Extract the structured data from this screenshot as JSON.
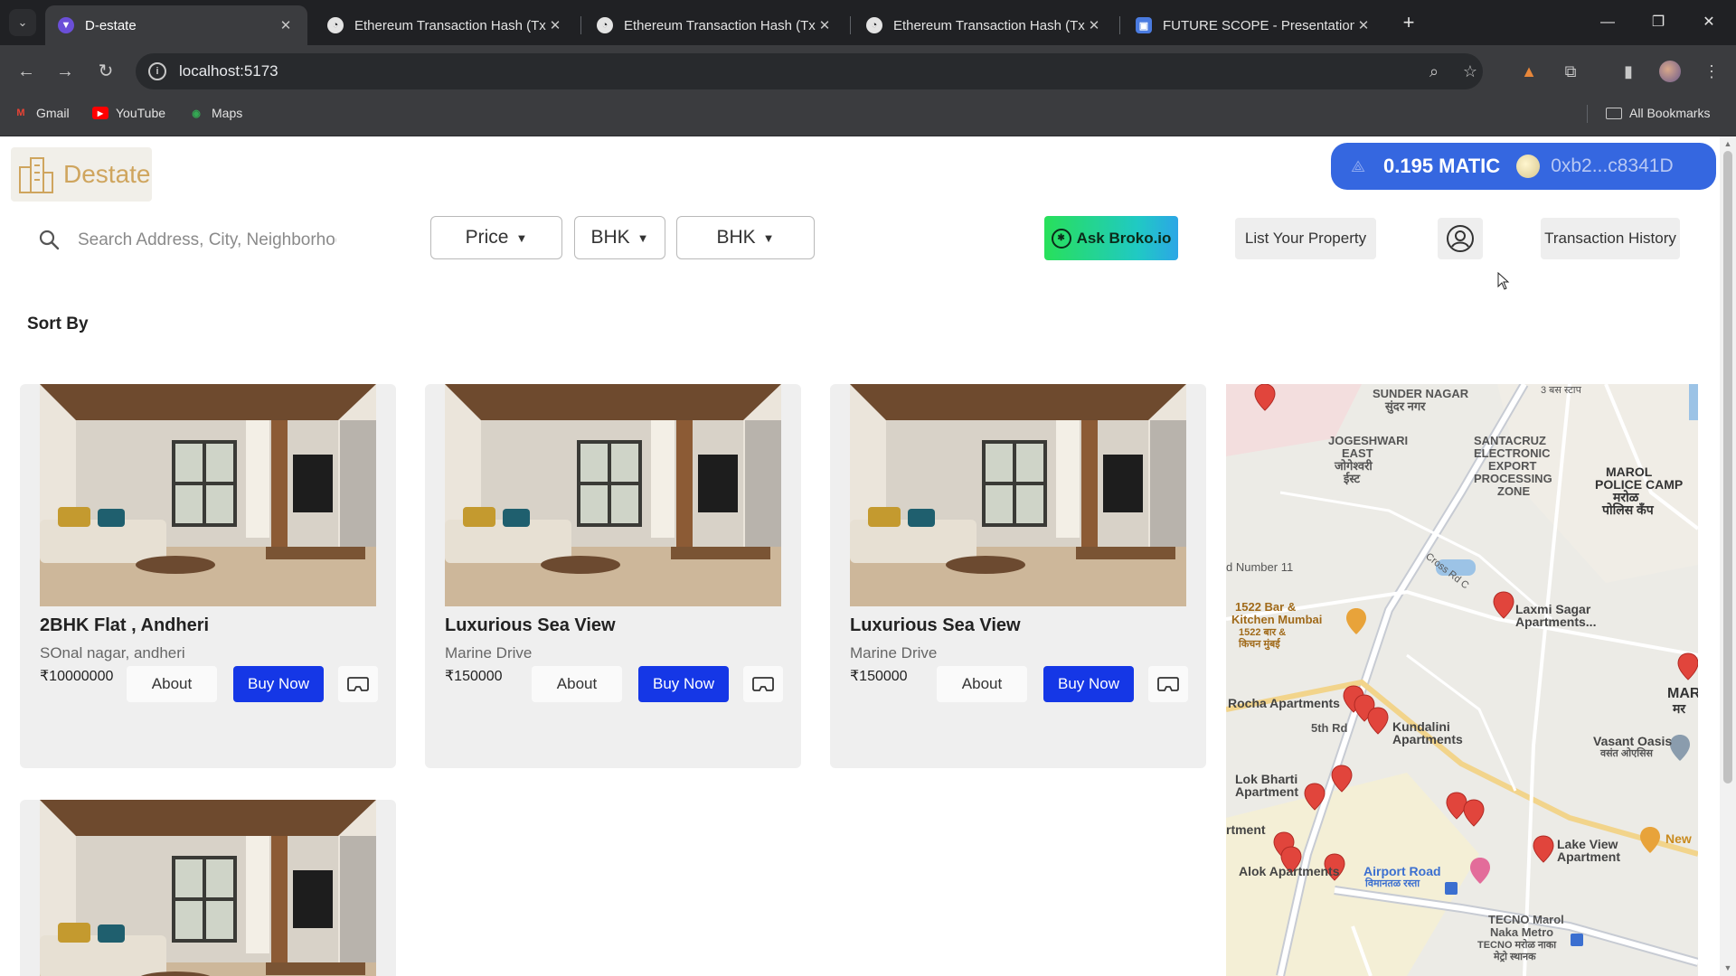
{
  "browser": {
    "tabs": [
      {
        "title": "D-estate",
        "active": true,
        "favicon": "destate-favicon"
      },
      {
        "title": "Ethereum Transaction Hash (Txh",
        "active": false,
        "favicon": "etherscan-favicon"
      },
      {
        "title": "Ethereum Transaction Hash (Txh",
        "active": false,
        "favicon": "etherscan-favicon"
      },
      {
        "title": "Ethereum Transaction Hash (Txh",
        "active": false,
        "favicon": "etherscan-favicon"
      },
      {
        "title": "FUTURE SCOPE - Presentation",
        "active": false,
        "favicon": "presentation-favicon"
      }
    ],
    "url": "localhost:5173",
    "bookmarks": [
      {
        "label": "Gmail",
        "icon": "gmail-icon"
      },
      {
        "label": "YouTube",
        "icon": "youtube-icon"
      },
      {
        "label": "Maps",
        "icon": "maps-icon"
      }
    ],
    "all_bookmarks": "All Bookmarks"
  },
  "header": {
    "logo_text": "Destate",
    "wallet": {
      "balance": "0.195 MATIC",
      "address": "0xb2...c8341D"
    }
  },
  "filters": {
    "search_placeholder": "Search Address, City, Neighborhood",
    "price_label": "Price",
    "bhk_label_1": "BHK",
    "bhk_label_2": "BHK"
  },
  "actions": {
    "ask_label": "Ask Broko.io",
    "list_property_label": "List Your Property",
    "transaction_history_label": "Transaction History"
  },
  "sort_by_label": "Sort By",
  "listings": [
    {
      "title": "2BHK Flat , Andheri",
      "location": "SOnal nagar, andheri",
      "price": "₹10000000",
      "about_label": "About",
      "buy_label": "Buy Now"
    },
    {
      "title": "Luxurious Sea View",
      "location": "Marine Drive",
      "price": "₹150000",
      "about_label": "About",
      "buy_label": "Buy Now"
    },
    {
      "title": "Luxurious Sea View",
      "location": "Marine Drive",
      "price": "₹150000",
      "about_label": "About",
      "buy_label": "Buy Now"
    },
    {
      "title": "",
      "location": "",
      "price": "",
      "about_label": "",
      "buy_label": ""
    }
  ],
  "map": {
    "labels": [
      "SUNDER NAGAR",
      "सुंदर नगर",
      "JOGESHWARI",
      "EAST",
      "जोगेश्वरी",
      "ईस्ट",
      "SANTACRUZ",
      "ELECTRONIC",
      "EXPORT",
      "PROCESSING",
      "ZONE",
      "MAROL",
      "POLICE CAMP",
      "मरोळ",
      "पोलिस कँप",
      "1522 Bar &",
      "Kitchen Mumbai",
      "1522 बार &",
      "किचन मुंबई",
      "Laxmi Sagar",
      "Apartments...",
      "Rocha Apartments",
      "5th Rd",
      "Kundalini",
      "Apartments",
      "Vasant Oasis",
      "वसंत ओएसिस",
      "Lok Bharti",
      "Apartment",
      "rtment",
      "Lake View",
      "Apartment",
      "Alok Apartments",
      "Airport Road",
      "विमानतळ रस्ता",
      "TECNO Marol",
      "Naka Metro",
      "TECNO मरोळ नाका",
      "मेट्रो स्थानक",
      "New",
      "MAR",
      "मर",
      "d Number 11",
      "Cross Rd C",
      "3 बस स्टाप"
    ]
  }
}
